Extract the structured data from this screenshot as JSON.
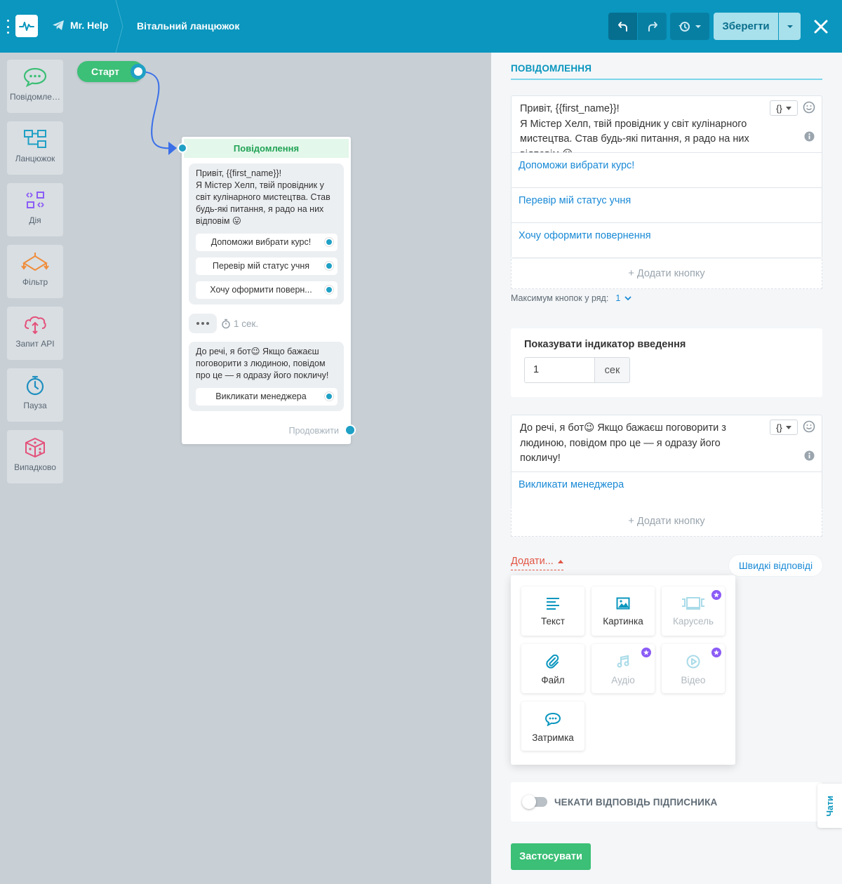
{
  "topbar": {
    "bot_name": "Mr. Help",
    "flow_title": "Вітальний ланцюжок",
    "save_label": "Зберегти"
  },
  "sidebar": {
    "items": [
      {
        "label": "Повідомлення",
        "icon": "message-bubble-icon"
      },
      {
        "label": "Ланцюжок",
        "icon": "flow-chain-icon"
      },
      {
        "label": "Дія",
        "icon": "action-icon"
      },
      {
        "label": "Фільтр",
        "icon": "filter-icon"
      },
      {
        "label": "Запит API",
        "icon": "cloud-api-icon"
      },
      {
        "label": "Пауза",
        "icon": "stopwatch-icon"
      },
      {
        "label": "Випадково",
        "icon": "dice-icon"
      }
    ]
  },
  "canvas": {
    "start_label": "Старт",
    "node": {
      "header": "Повідомлення",
      "message1": "Привіт, {{first_name}}!\nЯ Містер Хелп, твій провідник у світ кулінарного мистецтва. Став будь-які питання, я радо на них відповім 😛",
      "buttons1": [
        "Допоможи вибрати курс!",
        "Перевір мій статус учня",
        "Хочу оформити поверн..."
      ],
      "delay_label": "1 сек.",
      "message2": "До речі, я бот😉 Якщо бажаєш поговорити з людиною, повідом про це — я одразу його покличу!",
      "buttons2": [
        "Викликати менеджера"
      ],
      "continue_label": "Продовжити"
    }
  },
  "panel": {
    "title": "ПОВІДОМЛЕННЯ",
    "message1": "Привіт, {{first_name}}!\nЯ Містер Хелп, твій провідник у світ кулінарного мистецтва. Став будь-які питання, я радо на них відповім 😛",
    "var_label": "{}",
    "buttons1": [
      "Допоможи вибрати курс!",
      "Перевір мій статус учня",
      "Хочу оформити повернення"
    ],
    "add_button_label": "+ Додати кнопку",
    "max_buttons_label": "Максимум кнопок у ряд:",
    "max_buttons_value": "1",
    "typing_title": "Показувати індикатор введення",
    "typing_value": "1",
    "typing_unit": "сек",
    "message2": "До речі, я бот😉 Якщо бажаєш поговорити з людиною, повідом про це — я одразу його покличу!",
    "buttons2": [
      "Викликати менеджера"
    ],
    "add_menu_label": "Додати...",
    "quick_replies_label": "Швидкі відповіді",
    "add_menu": [
      {
        "label": "Текст",
        "icon": "text-lines-icon",
        "pro": false
      },
      {
        "label": "Картинка",
        "icon": "image-icon",
        "pro": false
      },
      {
        "label": "Карусель",
        "icon": "carousel-icon",
        "pro": true
      },
      {
        "label": "Файл",
        "icon": "paperclip-icon",
        "pro": false
      },
      {
        "label": "Аудіо",
        "icon": "music-note-icon",
        "pro": true
      },
      {
        "label": "Відео",
        "icon": "play-circle-icon",
        "pro": true
      },
      {
        "label": "Затримка",
        "icon": "typing-bubble-icon",
        "pro": false
      }
    ],
    "wait_reply_label": "ЧЕКАТИ ВІДПОВІДЬ ПІДПИСНИКА",
    "wait_reply_on": false,
    "apply_label": "Застосувати",
    "chats_tab_label": "Чати"
  },
  "colors": {
    "topbar": "#0a96be",
    "accent_green": "#3cbf76",
    "link_blue": "#1a8ad6",
    "add_red": "#e25545",
    "pro_purple": "#8b5cf6"
  }
}
